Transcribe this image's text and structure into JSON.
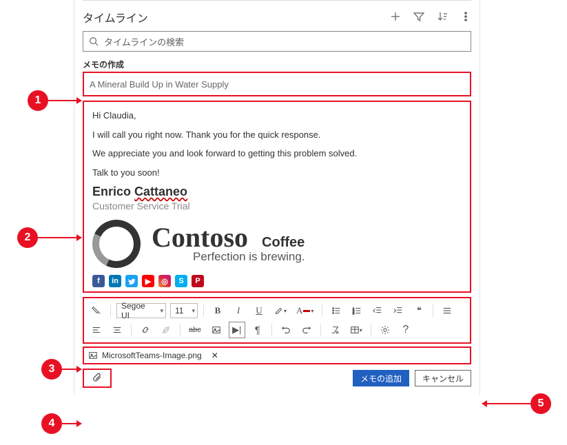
{
  "timeline": {
    "title": "タイムライン",
    "search_placeholder": "タイムラインの検索"
  },
  "note": {
    "create_label": "メモの作成",
    "title_value": "A Mineral Build Up in Water Supply",
    "body": {
      "greeting": "Hi Claudia,",
      "p1": "I will call you right now. Thank you for the quick response.",
      "p2": "We appreciate you and look forward to getting this problem solved.",
      "p3": "Talk to you soon!",
      "sig_first": "Enrico ",
      "sig_last": "Cattaneo",
      "sig_role": "Customer Service Trial",
      "brand_name": "Contoso",
      "brand_sub": "Coffee",
      "brand_tagline": "Perfection is brewing."
    }
  },
  "toolbar": {
    "font_family": "Segoe UI",
    "font_size": "11",
    "bold": "B",
    "italic": "I",
    "underline": "U",
    "font_color_label": "A",
    "strike": "abc",
    "pilcrow": "¶",
    "quote": "❝",
    "help": "?"
  },
  "attachment": {
    "filename": "MicrosoftTeams-Image.png"
  },
  "footer": {
    "add_note": "メモの追加",
    "cancel": "キャンセル"
  },
  "callouts": {
    "c1": "1",
    "c2": "2",
    "c3": "3",
    "c4": "4",
    "c5": "5"
  }
}
